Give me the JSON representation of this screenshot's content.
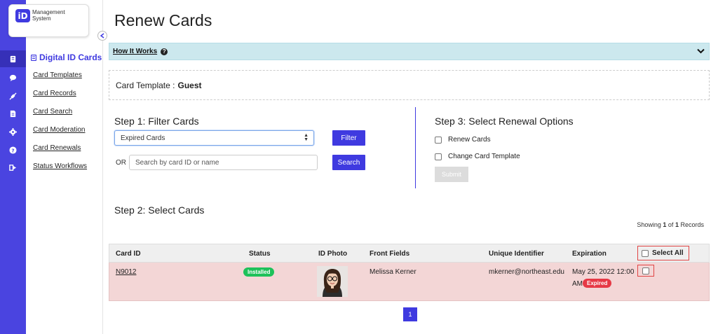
{
  "logo": {
    "badge": "iD",
    "line1": "Management",
    "line2": "System"
  },
  "rail": {
    "items": [
      {
        "icon": "id-card-icon",
        "active": true
      },
      {
        "icon": "chat-icon",
        "active": false
      },
      {
        "icon": "plug-icon",
        "active": false
      },
      {
        "icon": "document-icon",
        "active": false
      },
      {
        "icon": "gear-icon",
        "active": false
      },
      {
        "icon": "help-icon",
        "active": false
      },
      {
        "icon": "logout-icon",
        "active": false
      }
    ]
  },
  "sidebar": {
    "header": "Digital ID Cards",
    "links": [
      "Card Templates",
      "Card Records",
      "Card Search",
      "Card Moderation",
      "Card Renewals",
      "Status Workflows"
    ]
  },
  "page": {
    "title": "Renew Cards",
    "how_it_works": "How It Works",
    "template_label": "Card Template :",
    "template_value": "Guest"
  },
  "step1": {
    "title": "Step 1: Filter Cards",
    "select_value": "Expired Cards",
    "filter_button": "Filter",
    "or_label": "OR",
    "search_placeholder": "Search by card ID or name",
    "search_button": "Search"
  },
  "step3": {
    "title": "Step 3: Select Renewal Options",
    "option1": "Renew Cards",
    "option2": "Change Card Template",
    "submit": "Submit"
  },
  "step2": {
    "title": "Step 2: Select Cards",
    "showing_prefix": "Showing",
    "showing_from": "1",
    "showing_of": "of",
    "showing_total": "1",
    "showing_suffix": "Records"
  },
  "table": {
    "headers": {
      "card_id": "Card ID",
      "status": "Status",
      "photo": "ID Photo",
      "front": "Front Fields",
      "uid": "Unique Identifier",
      "expiration": "Expiration",
      "select_all": "Select All"
    },
    "rows": [
      {
        "card_id": "N9012",
        "status": "Installed",
        "front": "Melissa Kerner",
        "uid": "mkerner@northeast.edu",
        "exp_line1": "May 25, 2022 12:00",
        "exp_line2": "AM",
        "exp_badge": "Expired"
      }
    ]
  },
  "pagination": {
    "current": "1"
  },
  "colors": {
    "accent": "#3f3ae0",
    "rail": "#4a44e0",
    "info_bar": "#cce8ee",
    "expired_row": "#f3d6d6",
    "installed": "#1ec15a",
    "expired": "#e63946"
  }
}
